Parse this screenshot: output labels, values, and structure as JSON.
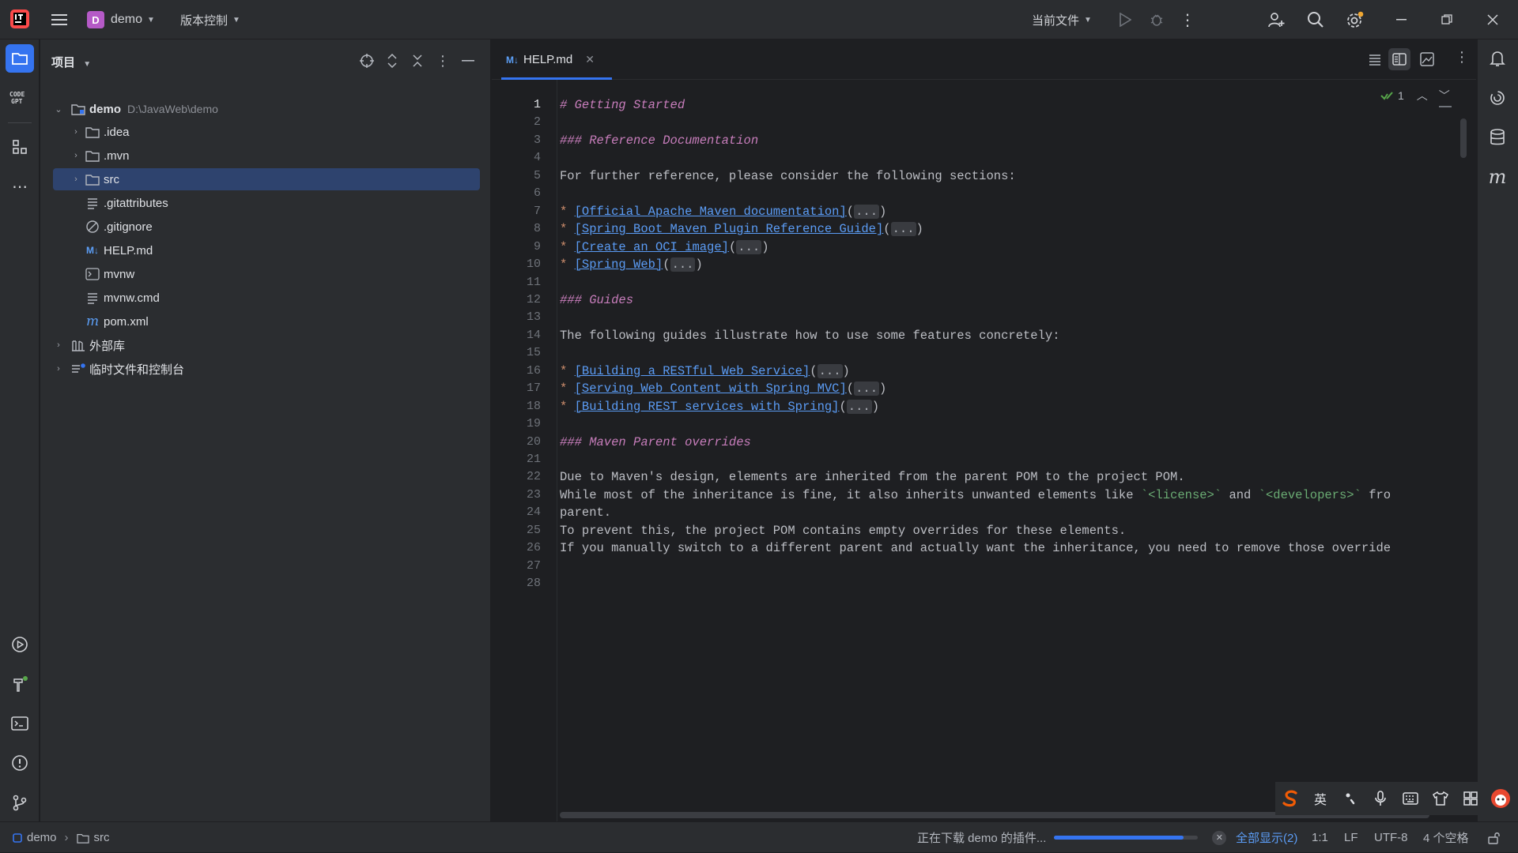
{
  "titlebar": {
    "project_initial": "D",
    "project_name": "demo",
    "vcs_label": "版本控制",
    "run_config": "当前文件"
  },
  "project_panel": {
    "title": "项目",
    "tree": [
      {
        "label": "demo",
        "path": "D:\\JavaWeb\\demo",
        "kind": "module",
        "expanded": true
      },
      {
        "label": ".idea",
        "kind": "folder"
      },
      {
        "label": ".mvn",
        "kind": "folder"
      },
      {
        "label": "src",
        "kind": "folder",
        "selected": true
      },
      {
        "label": ".gitattributes",
        "kind": "text"
      },
      {
        "label": ".gitignore",
        "kind": "ignore"
      },
      {
        "label": "HELP.md",
        "kind": "markdown"
      },
      {
        "label": "mvnw",
        "kind": "shell"
      },
      {
        "label": "mvnw.cmd",
        "kind": "text"
      },
      {
        "label": "pom.xml",
        "kind": "maven"
      },
      {
        "label": "外部库",
        "kind": "library"
      },
      {
        "label": "临时文件和控制台",
        "kind": "scratch"
      }
    ]
  },
  "editor": {
    "tab_label": "HELP.md",
    "tab_badge": "M↓",
    "inspection_count": "1",
    "lines": [
      "# Getting Started",
      "",
      "### Reference Documentation",
      "",
      "For further reference, please consider the following sections:",
      "",
      "* [Official Apache Maven documentation](...)",
      "* [Spring Boot Maven Plugin Reference Guide](...)",
      "* [Create an OCI image](...)",
      "* [Spring Web](...)",
      "",
      "### Guides",
      "",
      "The following guides illustrate how to use some features concretely:",
      "",
      "* [Building a RESTful Web Service](...)",
      "* [Serving Web Content with Spring MVC](...)",
      "* [Building REST services with Spring](...)",
      "",
      "### Maven Parent overrides",
      "",
      "Due to Maven's design, elements are inherited from the parent POM to the project POM.",
      "While most of the inheritance is fine, it also inherits unwanted elements like `<license>` and `<developers>` fro",
      "parent.",
      "To prevent this, the project POM contains empty overrides for these elements.",
      "If you manually switch to a different parent and actually want the inheritance, you need to remove those override",
      "",
      ""
    ]
  },
  "ime": {
    "lang": "英"
  },
  "statusbar": {
    "crumb_project": "demo",
    "crumb_folder": "src",
    "progress_text": "正在下载 demo 的插件...",
    "progress": 0.9,
    "show_all": "全部显示(2)",
    "position": "1:1",
    "line_sep": "LF",
    "encoding": "UTF-8",
    "indent": "4 个空格"
  },
  "colors": {
    "accent": "#3574f0",
    "selection": "#2e436e",
    "heading": "#c77dbb",
    "link": "#5b9cf5"
  }
}
